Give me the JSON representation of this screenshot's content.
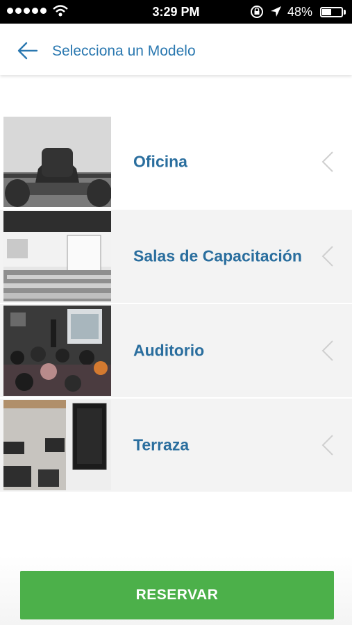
{
  "status_bar": {
    "time": "3:29 PM",
    "battery_percent": "48%",
    "battery_level": 0.48
  },
  "header": {
    "title": "Selecciona un Modelo",
    "back_icon": "arrow-left-icon"
  },
  "models": [
    {
      "label": "Oficina",
      "image": "office-chair-photo"
    },
    {
      "label": "Salas de Capacitación",
      "image": "training-room-photo"
    },
    {
      "label": "Auditorio",
      "image": "auditorium-photo"
    },
    {
      "label": "Terraza",
      "image": "terrace-photo"
    }
  ],
  "actions": {
    "reserve_label": "RESERVAR"
  },
  "colors": {
    "accent_blue": "#2a78b0",
    "label_blue": "#2a6e9e",
    "button_green": "#4cb04a"
  }
}
